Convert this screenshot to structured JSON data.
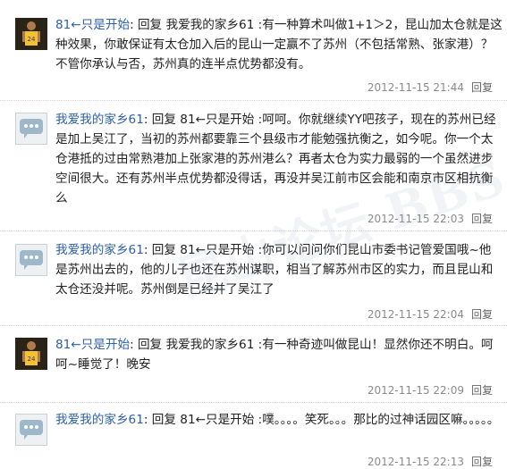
{
  "comments": [
    {
      "avatar": "player-avatar",
      "user": "81←只是开始",
      "body": "回复 我爱我的家乡61 :有一种算术叫做1+1＞2，昆山加太仓就是这种效果，你敢保证有太仓加入后的昆山一定赢不了苏州（不包括常熟、张家港）？不管你承认与否，苏州真的连半点优势都没有。",
      "time": "2012-11-15 21:44",
      "reply": "回复"
    },
    {
      "avatar": "bubble-avatar",
      "user": "我爱我的家乡61",
      "body": "回复 81←只是开始 :呵呵。你就继续YY吧孩子，现在的苏州已经是加上吴江了，当初的苏州都要靠三个县级市才能勉强抗衡之，如今呢。你一个太仓港抵的过由常熟港加上张家港的苏州港么？再者太仓为实力最弱的一个虽然进步空间很大。还有苏州半点优势都没得话，再没并吴江前市区会能和南京市区相抗衡么",
      "time": "2012-11-15 22:03",
      "reply": "回复"
    },
    {
      "avatar": "bubble-avatar",
      "user": "我爱我的家乡61",
      "body": "回复 81←只是开始 :你可以问问你们昆山市委书记管爱国哦~他是苏州出去的，他的儿子也还在苏州谋职，相当了解苏州市区的实力，而且昆山和太仓还没并呢。苏州倒是已经并了吴江了",
      "time": "2012-11-15 22:04",
      "reply": "回复"
    },
    {
      "avatar": "player-avatar",
      "user": "81←只是开始",
      "body": "回复 我爱我的家乡61 :有一种奇迹叫做昆山！显然你还不明白。呵呵~睡觉了！晚安",
      "time": "2012-11-15 22:09",
      "reply": "回复"
    },
    {
      "avatar": "bubble-avatar",
      "user": "我爱我的家乡61",
      "body": "回复 81←只是开始 :噗。。。。笑死。。。那比的过神话园区嘛。。。。。",
      "time": "2012-11-15 22:13",
      "reply": "回复"
    }
  ],
  "watermark": "昆山论坛 BBS",
  "colors": {
    "username": "#2c5fa4",
    "meta": "#8a8a8a",
    "text": "#222222"
  }
}
